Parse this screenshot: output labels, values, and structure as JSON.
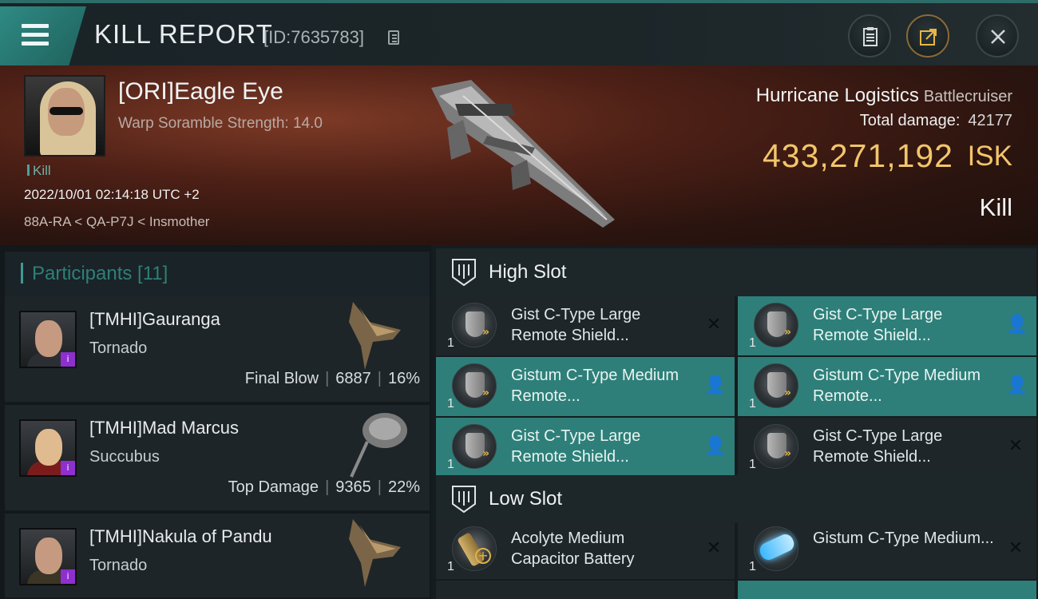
{
  "header": {
    "title": "KILL REPORT",
    "report_id": "[ID:7635783]"
  },
  "victim": {
    "name": "[ORI]Eagle Eye",
    "scramble": "Warp Soramble Strength: 14.0",
    "tag": "Kill",
    "datetime": "2022/10/01 02:14:18 UTC +2",
    "location": "88A-RA < QA-P7J < Insmother",
    "ship_name": "Hurricane Logistics",
    "ship_class": "Battlecruiser",
    "total_damage_label": "Total damage:",
    "total_damage": "42177",
    "isk_value": "433,271,192",
    "isk_unit": "ISK",
    "result": "Kill"
  },
  "participants": {
    "label": "Participants [11]",
    "items": [
      {
        "name": "[TMHI]Gauranga",
        "ship": "Tornado",
        "role": "Final Blow",
        "damage": "6887",
        "percent": "16%",
        "badge": "i"
      },
      {
        "name": "[TMHI]Mad Marcus",
        "ship": "Succubus",
        "role": "Top Damage",
        "damage": "9365",
        "percent": "22%",
        "badge": "i"
      },
      {
        "name": "[TMHI]Nakula of Pandu",
        "ship": "Tornado",
        "role": "",
        "damage": "",
        "percent": "",
        "badge": "i"
      }
    ]
  },
  "high_slot": {
    "label": "High Slot",
    "modules": [
      {
        "name": "Gist C-Type Large Remote Shield...",
        "qty": "1",
        "action": "✕"
      },
      {
        "name": "Gist C-Type Large Remote Shield...",
        "qty": "1",
        "action": "👤"
      },
      {
        "name": "Gistum C-Type Medium Remote...",
        "qty": "1",
        "action": "👤"
      },
      {
        "name": "Gistum C-Type Medium Remote...",
        "qty": "1",
        "action": "👤"
      },
      {
        "name": "Gist C-Type Large Remote Shield...",
        "qty": "1",
        "action": "👤"
      },
      {
        "name": "Gist C-Type Large Remote Shield...",
        "qty": "1",
        "action": "✕"
      }
    ]
  },
  "low_slot": {
    "label": "Low Slot",
    "modules": [
      {
        "name": "Acolyte Medium Capacitor Battery",
        "qty": "1",
        "action": "✕"
      },
      {
        "name": "Gistum C-Type Medium...",
        "qty": "1",
        "action": "✕"
      }
    ]
  },
  "colors": {
    "accent_teal": "#2e7f79",
    "isk_gold": "#f3c56b",
    "purple_badge": "#8e2fcf"
  },
  "icons": [
    "menu-icon",
    "copy-icon",
    "clipboard-icon",
    "share-icon",
    "close-icon",
    "slot-icon",
    "shield-module-icon",
    "pilot-icon",
    "remove-icon"
  ]
}
